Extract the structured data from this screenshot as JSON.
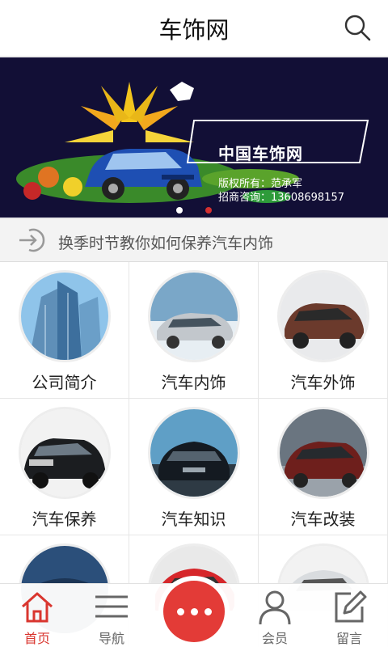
{
  "header": {
    "title": "车饰网"
  },
  "banner": {
    "brand": "中国车饰网",
    "copyright": "版权所有：范承军",
    "contact": "招商咨询：13608698157"
  },
  "notice": {
    "text": "换季时节教你如何保养汽车内饰"
  },
  "grid": {
    "items": [
      {
        "label": "公司简介",
        "icon": "building-photo"
      },
      {
        "label": "汽车内饰",
        "icon": "silver-sedan-photo"
      },
      {
        "label": "汽车外饰",
        "icon": "brown-suv-photo"
      },
      {
        "label": "汽车保养",
        "icon": "black-suv-photo"
      },
      {
        "label": "汽车知识",
        "icon": "mercedes-photo"
      },
      {
        "label": "汽车改装",
        "icon": "red-sedan-photo"
      },
      {
        "label": "",
        "icon": "blue-car-photo"
      },
      {
        "label": "",
        "icon": "red-car-photo"
      },
      {
        "label": "",
        "icon": "white-car-photo"
      }
    ]
  },
  "tabbar": {
    "home": "首页",
    "nav": "导航",
    "member": "会员",
    "message": "留言"
  },
  "colors": {
    "accent": "#e33b37",
    "bannerBg": "#120f36"
  }
}
